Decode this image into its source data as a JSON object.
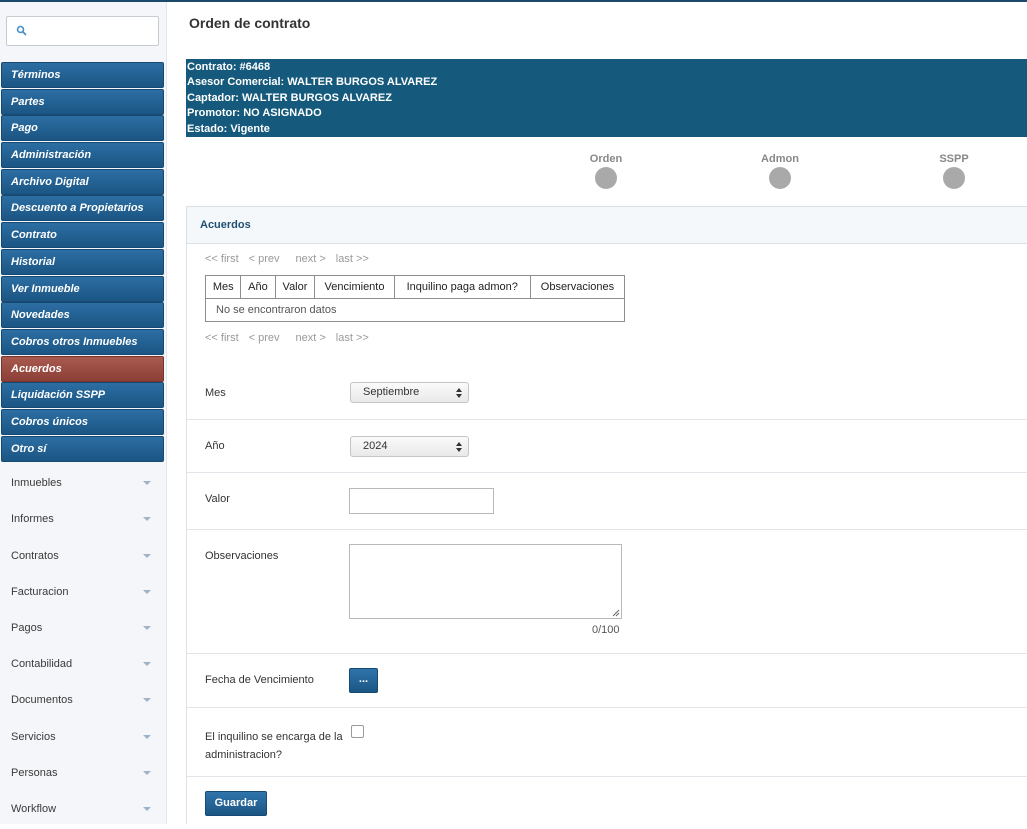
{
  "page": {
    "title": "Orden de contrato"
  },
  "search": {
    "placeholder": ""
  },
  "sidebar": {
    "menu": [
      {
        "label": "Términos",
        "active": false
      },
      {
        "label": "Partes",
        "active": false
      },
      {
        "label": "Pago",
        "active": false
      },
      {
        "label": "Administración",
        "active": false
      },
      {
        "label": "Archivo Digital",
        "active": false
      },
      {
        "label": "Descuento a Propietarios",
        "active": false
      },
      {
        "label": "Contrato",
        "active": false
      },
      {
        "label": "Historial",
        "active": false
      },
      {
        "label": "Ver Inmueble",
        "active": false
      },
      {
        "label": "Novedades",
        "active": false
      },
      {
        "label": "Cobros otros Inmuebles",
        "active": false
      },
      {
        "label": "Acuerdos",
        "active": true
      },
      {
        "label": "Liquidación SSPP",
        "active": false
      },
      {
        "label": "Cobros únicos",
        "active": false
      },
      {
        "label": "Otro sí",
        "active": false
      }
    ],
    "categories": [
      "Inmuebles",
      "Informes",
      "Contratos",
      "Facturacion",
      "Pagos",
      "Contabilidad",
      "Documentos",
      "Servicios",
      "Personas",
      "Workflow"
    ]
  },
  "contract": {
    "line1": "Contrato: #6468",
    "line2": "Asesor Comercial: WALTER BURGOS ALVAREZ",
    "line3": "Captador: WALTER BURGOS ALVAREZ",
    "line4": "Promotor: NO ASIGNADO",
    "line5": "Estado: Vigente"
  },
  "steps": [
    "Orden",
    "Admon",
    "SSPP"
  ],
  "section": {
    "title": "Acuerdos"
  },
  "pager": {
    "first": "<< first",
    "prev": "< prev",
    "next": "next >",
    "last": "last >>"
  },
  "table": {
    "columns": [
      "Mes",
      "Año",
      "Valor",
      "Vencimiento",
      "Inquilino paga admon?",
      "Observaciones"
    ],
    "empty": "No se encontraron datos"
  },
  "form": {
    "mes_label": "Mes",
    "mes_value": "Septiembre",
    "anio_label": "Año",
    "anio_value": "2024",
    "valor_label": "Valor",
    "valor_value": "",
    "obs_label": "Observaciones",
    "obs_value": "",
    "obs_counter": "0/100",
    "fecha_label": "Fecha de Vencimiento",
    "fecha_button": "...",
    "inquilino_label_1": "El inquilino se encarga de la",
    "inquilino_label_2": "administracion?",
    "inquilino_checked": false,
    "save": "Guardar"
  }
}
